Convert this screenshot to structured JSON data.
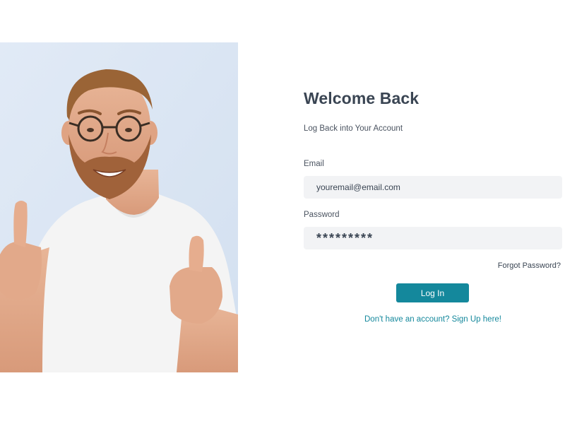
{
  "login": {
    "title": "Welcome Back",
    "subtitle": "Log Back into Your Account",
    "email_label": "Email",
    "email_value": "youremail@email.com",
    "password_label": "Password",
    "password_value": "*********",
    "forgot_password": "Forgot Password?",
    "login_button": "Log In",
    "signup_link": "Don't have an account? Sign Up here!"
  },
  "hero": {
    "image_alt": "Smiling bearded man with glasses giving two thumbs up"
  },
  "colors": {
    "accent": "#14889c",
    "heading": "#3a4553",
    "input_bg": "#f2f3f5",
    "hero_bg": "#dbe6f3"
  }
}
